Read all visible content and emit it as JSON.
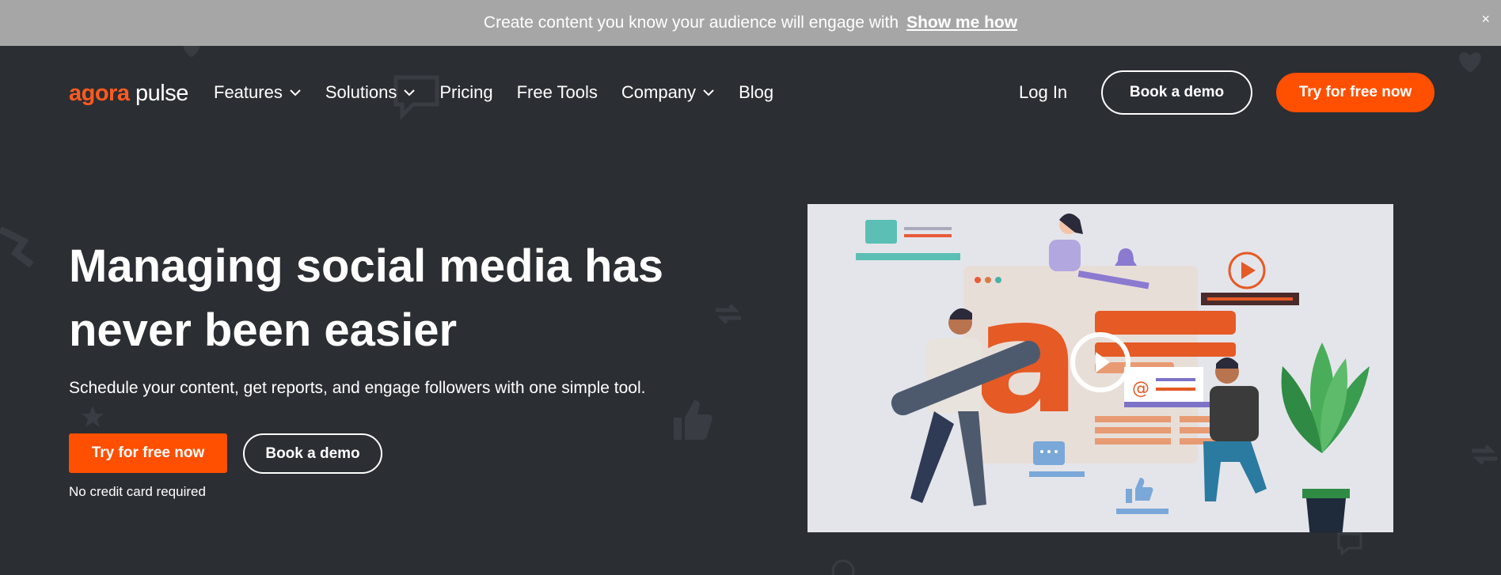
{
  "announce": {
    "text": "Create content you know your audience will engage with",
    "link": "Show me how",
    "close": "×"
  },
  "logo": {
    "part1": "agora",
    "part2": "pulse"
  },
  "nav": {
    "items": [
      {
        "label": "Features",
        "dropdown": true
      },
      {
        "label": "Solutions",
        "dropdown": true
      },
      {
        "label": "Pricing",
        "dropdown": false
      },
      {
        "label": "Free Tools",
        "dropdown": false
      },
      {
        "label": "Company",
        "dropdown": true
      },
      {
        "label": "Blog",
        "dropdown": false
      }
    ],
    "login": "Log In",
    "demo": "Book a demo",
    "trial": "Try for free now"
  },
  "hero": {
    "title": "Managing social media has never been easier",
    "subtitle": "Schedule your content, get reports, and engage followers with one simple tool.",
    "trial": "Try for free now",
    "demo": "Book a demo",
    "note": "No credit card required"
  },
  "colors": {
    "background": "#2b2e33",
    "accent": "#ff4f00",
    "announce_bar": "#a6a6a6"
  }
}
